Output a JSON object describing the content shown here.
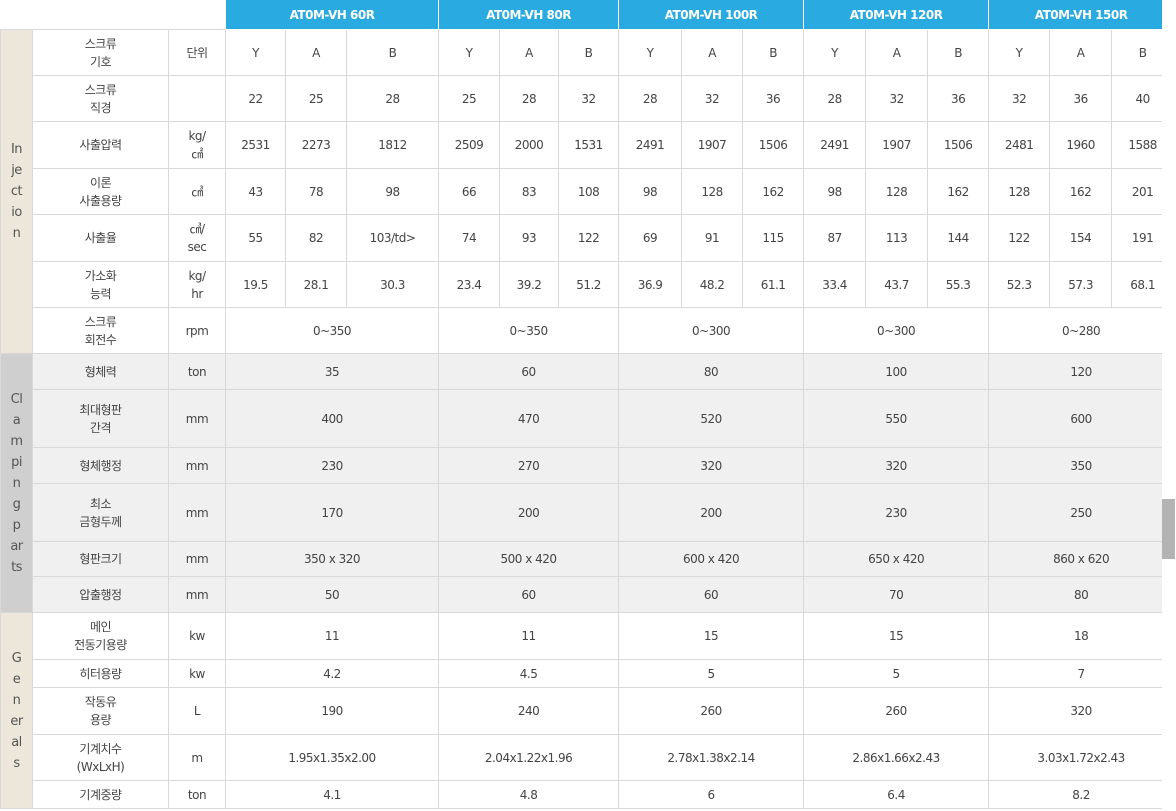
{
  "models": [
    "AT0M-VH 60R",
    "AT0M-VH 80R",
    "AT0M-VH 100R",
    "AT0M-VH 120R",
    "AT0M-VH 150R"
  ],
  "sections": {
    "injection": "Injection",
    "clamping": "Clamping parts",
    "generals": "Generals"
  },
  "injection_rows": [
    {
      "label": "스크류\n기호",
      "unit": "단위",
      "values": [
        "Y",
        "A",
        "B",
        "Y",
        "A",
        "B",
        "Y",
        "A",
        "B",
        "Y",
        "A",
        "B",
        "Y",
        "A",
        "B"
      ]
    },
    {
      "label": "스크류\n직경",
      "unit": "",
      "values": [
        "22",
        "25",
        "28",
        "25",
        "28",
        "32",
        "28",
        "32",
        "36",
        "28",
        "32",
        "36",
        "32",
        "36",
        "40"
      ]
    },
    {
      "label": "사출압력",
      "unit": "kg/\n㎠",
      "values": [
        "2531",
        "2273",
        "1812",
        "2509",
        "2000",
        "1531",
        "2491",
        "1907",
        "1506",
        "2491",
        "1907",
        "1506",
        "2481",
        "1960",
        "1588"
      ]
    },
    {
      "label": "이론\n사출용량",
      "unit": "㎤",
      "values": [
        "43",
        "78",
        "98",
        "66",
        "83",
        "108",
        "98",
        "128",
        "162",
        "98",
        "128",
        "162",
        "128",
        "162",
        "201"
      ]
    },
    {
      "label": "사출율",
      "unit": "㎤/\nsec",
      "values": [
        "55",
        "82",
        "103/td>",
        "74",
        "93",
        "122",
        "69",
        "91",
        "115",
        "87",
        "113",
        "144",
        "122",
        "154",
        "191"
      ]
    },
    {
      "label": "가소화\n능력",
      "unit": "kg/\nhr",
      "values": [
        "19.5",
        "28.1",
        "30.3",
        "23.4",
        "39.2",
        "51.2",
        "36.9",
        "48.2",
        "61.1",
        "33.4",
        "43.7",
        "55.3",
        "52.3",
        "57.3",
        "68.1"
      ]
    },
    {
      "label": "스크류\n회전수",
      "unit": "rpm",
      "merged": [
        "0~350",
        "0~350",
        "0~300",
        "0~300",
        "0~280"
      ]
    }
  ],
  "clamping_rows": [
    {
      "label": "형체력",
      "unit": "ton",
      "merged": [
        "35",
        "60",
        "80",
        "100",
        "120"
      ]
    },
    {
      "label": "최대형판\n간격",
      "unit": "mm",
      "merged": [
        "400",
        "470",
        "520",
        "550",
        "600"
      ]
    },
    {
      "label": "형체행정",
      "unit": "mm",
      "merged": [
        "230",
        "270",
        "320",
        "320",
        "350"
      ]
    },
    {
      "label": "최소\n금형두께",
      "unit": "mm",
      "merged": [
        "170",
        "200",
        "200",
        "230",
        "250"
      ]
    },
    {
      "label": "형판크기",
      "unit": "mm",
      "merged": [
        "350 x 320",
        "500 x 420",
        "600 x 420",
        "650 x 420",
        "860 x 620"
      ]
    },
    {
      "label": "압출행정",
      "unit": "mm",
      "merged": [
        "50",
        "60",
        "60",
        "70",
        "80"
      ]
    }
  ],
  "general_rows": [
    {
      "label": "메인\n전동기용량",
      "unit": "kw",
      "merged": [
        "11",
        "11",
        "15",
        "15",
        "18"
      ]
    },
    {
      "label": "히터용량",
      "unit": "kw",
      "merged": [
        "4.2",
        "4.5",
        "5",
        "5",
        "7"
      ]
    },
    {
      "label": "작동유\n용량",
      "unit": "L",
      "merged": [
        "190",
        "240",
        "260",
        "260",
        "320"
      ]
    },
    {
      "label": "기계치수\n(WxLxH)",
      "unit": "m",
      "merged": [
        "1.95x1.35x2.00",
        "2.04x1.22x1.96",
        "2.78x1.38x2.14",
        "2.86x1.66x2.43",
        "3.03x1.72x2.43"
      ]
    },
    {
      "label": "기계중량",
      "unit": "ton",
      "merged": [
        "4.1",
        "4.8",
        "6",
        "6.4",
        "8.2"
      ]
    }
  ]
}
